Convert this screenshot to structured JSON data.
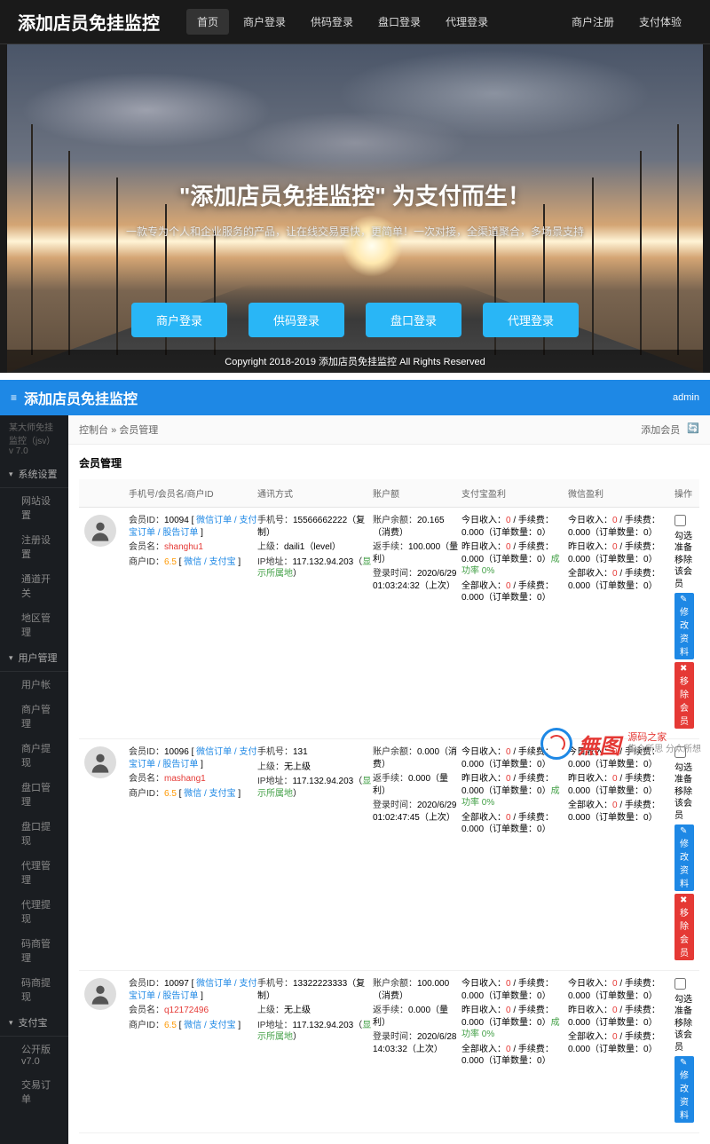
{
  "landing": {
    "logo": "添加店员免挂监控",
    "nav": [
      "首页",
      "商户登录",
      "供码登录",
      "盘口登录",
      "代理登录"
    ],
    "nav_right": [
      "商户注册",
      "支付体验"
    ],
    "hero_title": "\"添加店员免挂监控\"  为支付而生！",
    "hero_subtitle": "一款专为个人和企业服务的产品，让在线交易更快，更简单！一次对接，全渠道聚合，多场景支持",
    "hero_buttons": [
      "商户登录",
      "供码登录",
      "盘口登录",
      "代理登录"
    ],
    "footer": "Copyright 2018-2019 添加店员免挂监控 All Rights Reserved"
  },
  "admin": {
    "header_title": "添加店员免挂监控",
    "header_user": "admin",
    "sidebar_sub": "某大师免挂监控（jsv）v 7.0",
    "groups": [
      {
        "label": "系统设置",
        "open": true,
        "items": [
          "网站设置",
          "注册设置",
          "通道开关",
          "地区管理"
        ]
      },
      {
        "label": "用户管理",
        "open": true,
        "items": [
          "用户帐",
          "商户管理",
          "商户提现",
          "盘口管理",
          "盘口提现",
          "代理管理",
          "代理提现",
          "码商管理",
          "码商提现"
        ]
      },
      {
        "label": "支付宝",
        "open": true,
        "items": [
          "公开版 v7.0",
          "交易订单"
        ]
      }
    ],
    "breadcrumb_left": "控制台",
    "breadcrumb_current": "会员管理",
    "breadcrumb_right": [
      "添加会员",
      "🔄"
    ],
    "panel_title": "会员管理",
    "table_headers": {
      "col1": "手机号/会员名/商户ID",
      "col2": "通讯方式",
      "col3": "账户额",
      "col4": "支付宝盈利",
      "col5": "微信盈利",
      "col6": "操作"
    },
    "rows": [
      {
        "member_id": "10094",
        "tags": "微信订单 / 支付宝订单 / 股告订单",
        "member_name": "shanghu1",
        "merchant_id": "6.5",
        "merchant_tags": "微信 / 支付宝",
        "phone": "15566662222（复制）",
        "superior": "daili1（level）",
        "ip": "117.132.94.203（显示所属地）",
        "balance": "20.165（消费）",
        "refund": "100.000（量利）",
        "login_time": "2020/6/29 01:03:24:32（上次）",
        "col4": {
          "l1": "今日收入：0 / 手续费：0.000（订单数量：0）",
          "l2": "昨日收入：0 / 手续费：0.000（订单数量：0）成功率 0%",
          "l3": "全部收入：0 / 手续费：0.000（订单数量：0）"
        },
        "col5": {
          "l1": "今日收入：0 / 手续费：0.000（订单数量：0）",
          "l2": "昨日收入：0 / 手续费：0.000（订单数量：0）",
          "l3": "全部收入：0 / 手续费：0.000（订单数量：0）"
        },
        "action_chk": "勾选 准备移除该会员",
        "btn1": "✎ 修改资料",
        "btn2": "✖ 移除会员"
      },
      {
        "member_id": "10096",
        "tags": "微信订单 / 支付宝订单 / 股告订单",
        "member_name": "mashang1",
        "merchant_id": "6.5",
        "merchant_tags": "微信 / 支付宝",
        "phone": "131",
        "superior": "无上级",
        "ip": "117.132.94.203（显示所属地）",
        "balance": "0.000（消费）",
        "refund": "0.000（量利）",
        "login_time": "2020/6/29 01:02:47:45（上次）",
        "col4": {
          "l1": "今日收入：0 / 手续费：0.000（订单数量：0）",
          "l2": "昨日收入：0 / 手续费：0.000（订单数量：0）成功率 0%",
          "l3": "全部收入：0 / 手续费：0.000（订单数量：0）"
        },
        "col5": {
          "l1": "今日收入：0 / 手续费：0.000（订单数量：0）",
          "l2": "昨日收入：0 / 手续费：0.000（订单数量：0）",
          "l3": "全部收入：0 / 手续费：0.000（订单数量：0）"
        },
        "action_chk": "勾选 准备移除该会员",
        "btn1": "✎ 修改资料",
        "btn2": "✖ 移除会员"
      },
      {
        "member_id": "10097",
        "tags": "微信订单 / 支付宝订单 / 股告订单",
        "member_name": "q12172496",
        "merchant_id": "6.5",
        "merchant_tags": "微信 / 支付宝",
        "phone": "13322223333（复制）",
        "superior": "无上级",
        "ip": "117.132.94.203（显示所属地）",
        "balance": "100.000（消费）",
        "refund": "0.000（量利）",
        "login_time": "2020/6/28 14:03:32（上次）",
        "col4": {
          "l1": "今日收入：0 / 手续费：0.000（订单数量：0）",
          "l2": "昨日收入：0 / 手续费：0.000（订单数量：0）成功率 0%",
          "l3": "全部收入：0 / 手续费：0.000（订单数量：0）"
        },
        "col5": {
          "l1": "今日收入：0 / 手续费：0.000（订单数量：0）",
          "l2": "昨日收入：0 / 手续费：0.000（订单数量：0）",
          "l3": "全部收入：0 / 手续费：0.000（订单数量：0）"
        },
        "action_chk": "勾选 准备移除该会员",
        "btn1": "✎ 修改资料",
        "btn2": ""
      }
    ]
  },
  "watermark": {
    "brand": "無图",
    "lines": [
      "源码之家",
      "集众所思 分众所想"
    ]
  }
}
